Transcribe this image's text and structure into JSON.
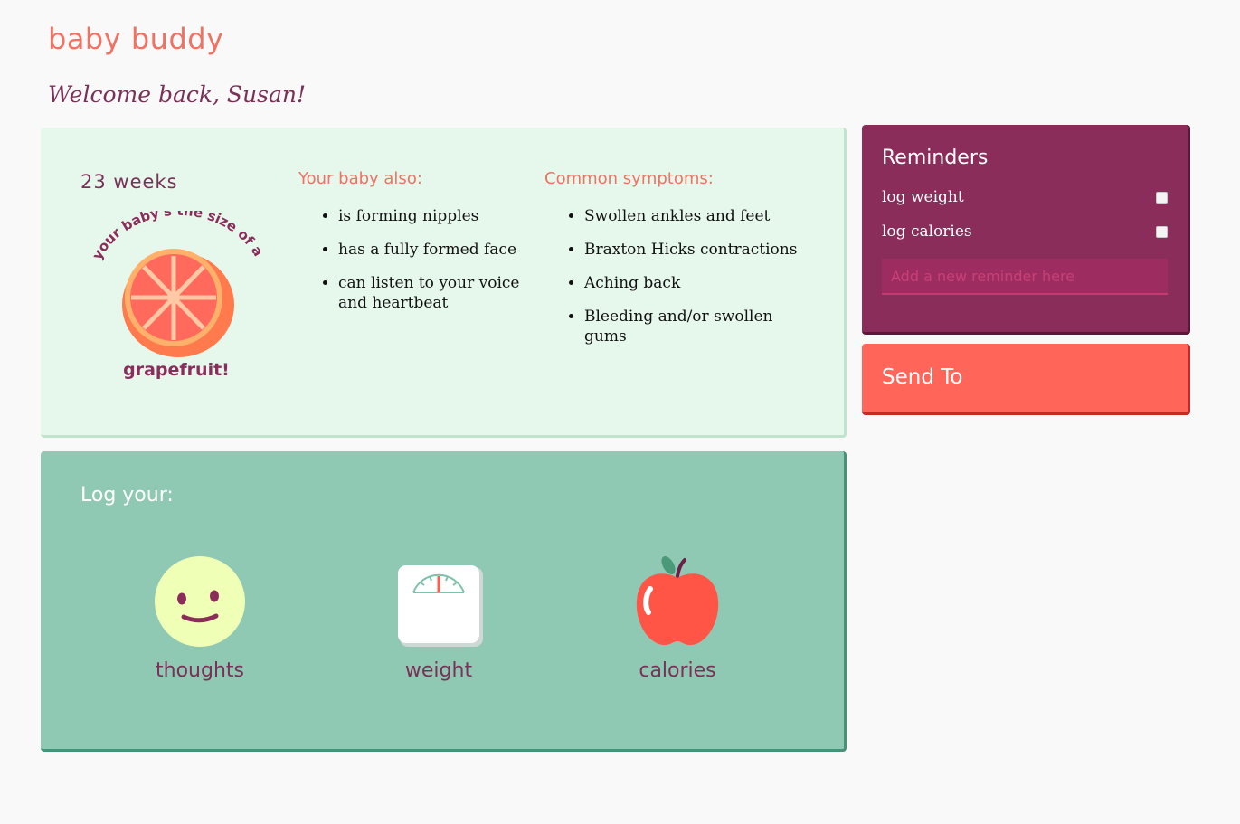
{
  "brand": {
    "name": "baby buddy"
  },
  "welcome": "Welcome back, Susan!",
  "pregnancy": {
    "weeks": "23 weeks",
    "size_caption_top": "your baby's the size of a",
    "size_caption_bottom": "grapefruit!"
  },
  "baby_also": {
    "heading": "Your baby also:",
    "items": [
      "is forming nipples",
      "has a fully formed face",
      "can listen to your voice and heartbeat"
    ]
  },
  "symptoms": {
    "heading": "Common symptoms:",
    "items": [
      "Swollen ankles and feet",
      "Braxton Hicks contractions",
      "Aching back",
      "Bleeding and/or swollen gums"
    ]
  },
  "log": {
    "title": "Log your:",
    "items": [
      {
        "label": "thoughts",
        "icon": "smiley-face-icon"
      },
      {
        "label": "weight",
        "icon": "bathroom-scale-icon"
      },
      {
        "label": "calories",
        "icon": "apple-icon"
      }
    ]
  },
  "reminders": {
    "title": "Reminders",
    "items": [
      {
        "label": "log weight",
        "checked": false
      },
      {
        "label": "log calories",
        "checked": false
      }
    ],
    "input_placeholder": "Add a new reminder here"
  },
  "send_to": {
    "title": "Send To"
  },
  "colors": {
    "coral": "#f07263",
    "plum": "#8b2d5a",
    "mint_bg": "#e6f8ec",
    "teal_bg": "#8fc9b4",
    "send_bg": "#ff6659"
  }
}
